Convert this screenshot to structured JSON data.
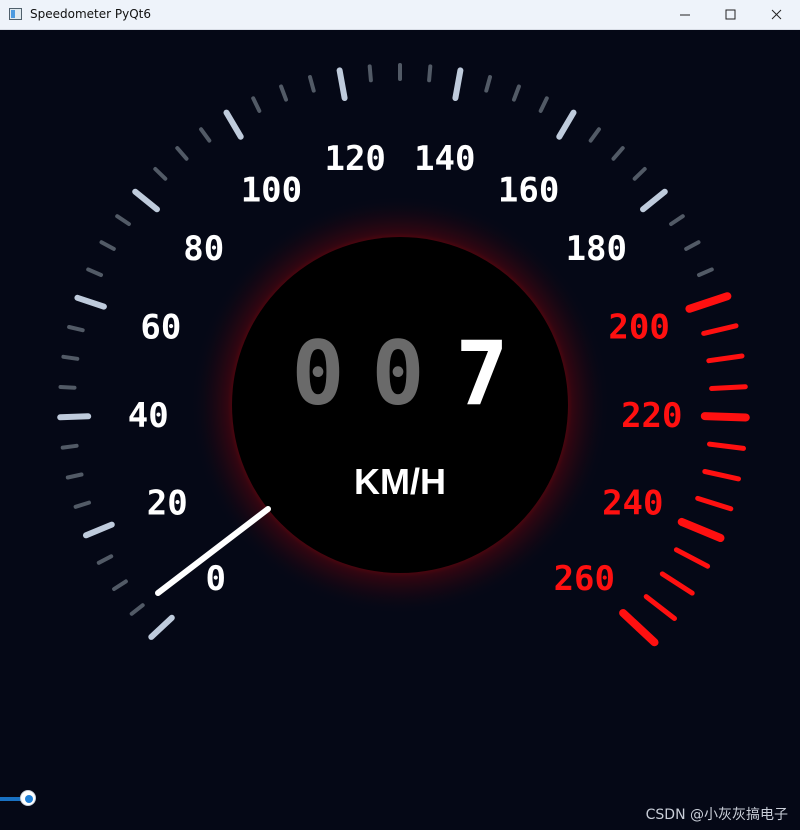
{
  "window": {
    "title": "Speedometer PyQt6",
    "controls": [
      "minimize",
      "maximize",
      "close"
    ]
  },
  "gauge": {
    "current_speed": 7,
    "display_digits": [
      "0",
      "0",
      "7"
    ],
    "unit": "KM/H",
    "min_speed": 0,
    "max_speed": 260,
    "tick_labels": [
      "0",
      "20",
      "40",
      "60",
      "80",
      "100",
      "120",
      "140",
      "160",
      "180",
      "200",
      "220",
      "240",
      "260"
    ],
    "red_zone_start": 200,
    "colors": {
      "background": "#050816",
      "scale_tick": "#525a66",
      "major_tick": "#bfcbdc",
      "red_zone": "#ff1010",
      "needle": "#ffffff",
      "dim_digit": "#6a6a6a",
      "active_digit": "#ffffff"
    }
  },
  "slider": {
    "value": 7,
    "min": 0,
    "max": 260
  },
  "watermark": "CSDN @小灰灰搞电子"
}
